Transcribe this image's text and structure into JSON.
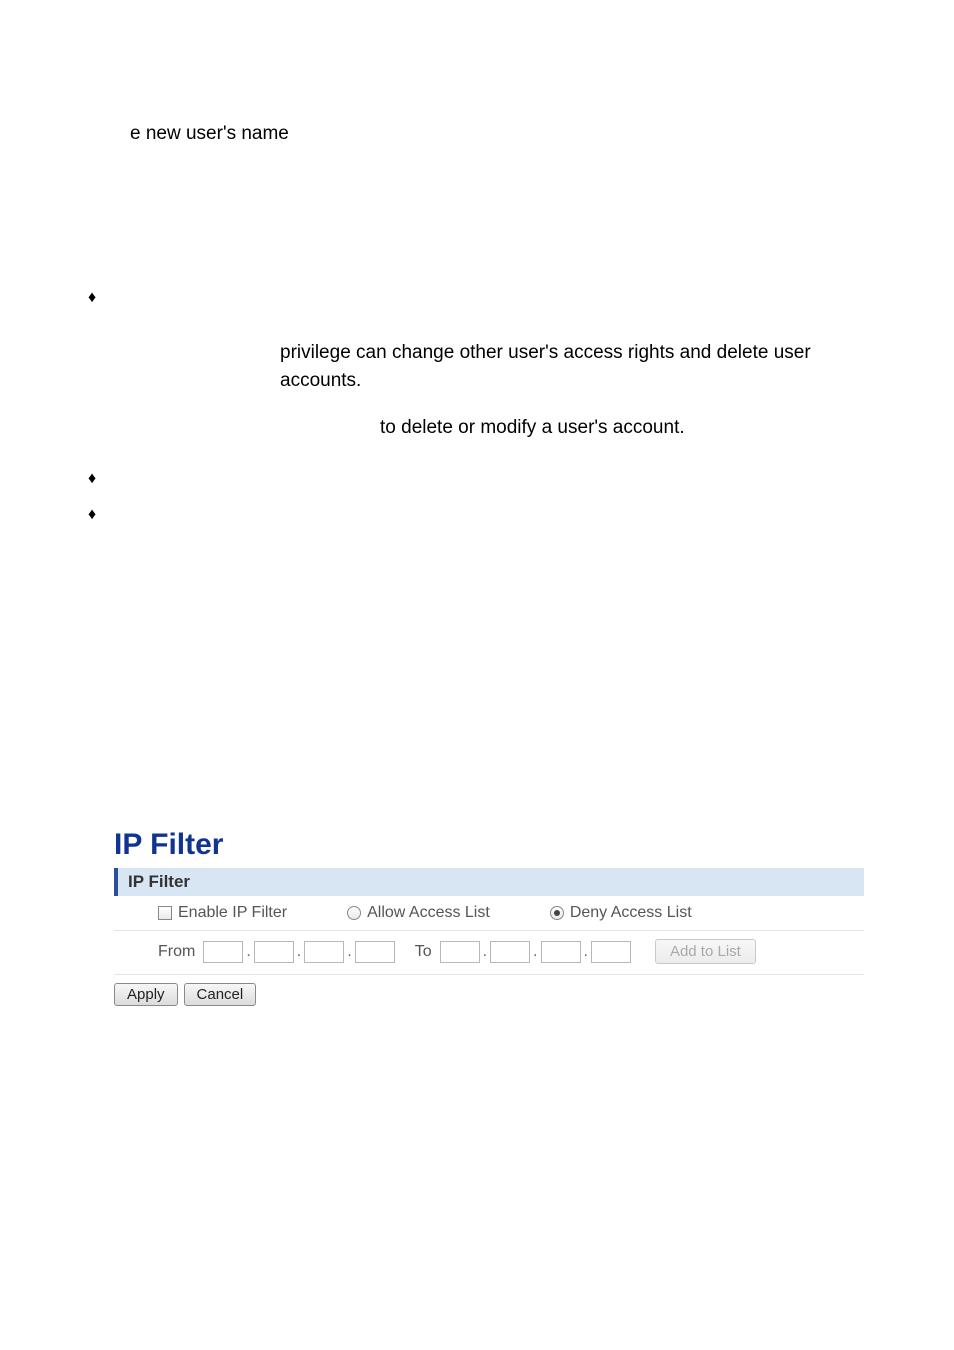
{
  "text": {
    "line1": "e new user's name",
    "line2": "privilege can change other user's access rights and delete user accounts.",
    "line3": "to delete or modify a user's account."
  },
  "ipfilter": {
    "title": "IP Filter",
    "section_label": "IP Filter",
    "enable_label": "Enable IP Filter",
    "allow_label": "Allow Access List",
    "deny_label": "Deny Access List",
    "from_label": "From",
    "to_label": "To",
    "add_label": "Add to List",
    "apply_label": "Apply",
    "cancel_label": "Cancel",
    "enable_checked": false,
    "mode_selected": "deny"
  }
}
